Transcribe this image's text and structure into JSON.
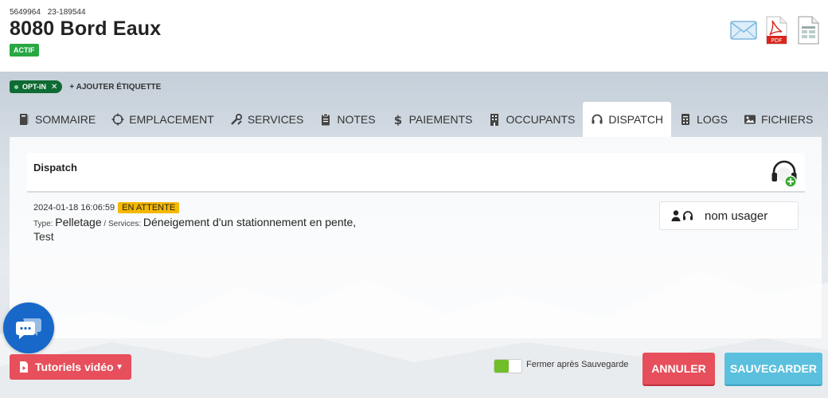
{
  "header": {
    "id_primary": "5649964",
    "id_secondary": "23-189544",
    "title": "8080 Bord Eaux",
    "status": "ACTIF"
  },
  "header_icons": [
    "mail-icon",
    "pdf-icon",
    "document-icon"
  ],
  "tags": {
    "chip_label": "OPT-IN",
    "add_label": "+ AJOUTER ÉTIQUETTE"
  },
  "tabs": [
    {
      "label": "SOMMAIRE",
      "icon": "book-icon"
    },
    {
      "label": "EMPLACEMENT",
      "icon": "crosshair-icon"
    },
    {
      "label": "SERVICES",
      "icon": "tools-icon"
    },
    {
      "label": "NOTES",
      "icon": "clipboard-icon"
    },
    {
      "label": "PAIEMENTS",
      "icon": "dollar-icon"
    },
    {
      "label": "OCCUPANTS",
      "icon": "building-icon"
    },
    {
      "label": "DISPATCH",
      "icon": "headset-icon",
      "active": true
    },
    {
      "label": "LOGS",
      "icon": "log-icon"
    },
    {
      "label": "FICHIERS",
      "icon": "image-icon"
    }
  ],
  "dispatch": {
    "card_title": "Dispatch",
    "entry": {
      "timestamp": "2024-01-18 16:06:59",
      "status_badge": "EN ATTENTE",
      "type_label": "Type:",
      "type_value": "Pelletage",
      "services_label": "/ Services:",
      "services_value": "Déneigement d'un stationnement en pente,",
      "note": "Test"
    },
    "user": "nom usager"
  },
  "footer": {
    "tutorial_label": "Tutoriels vidéo",
    "toggle_label": "Fermer après Sauvegarde",
    "cancel_label": "ANNULER",
    "save_label": "SAUVEGARDER"
  },
  "colors": {
    "active_badge": "#27a844",
    "tag": "#0e6b33",
    "waiting": "#f5b800",
    "danger": "#e64f5b",
    "info": "#5bc0de",
    "chat": "#1768c9"
  }
}
